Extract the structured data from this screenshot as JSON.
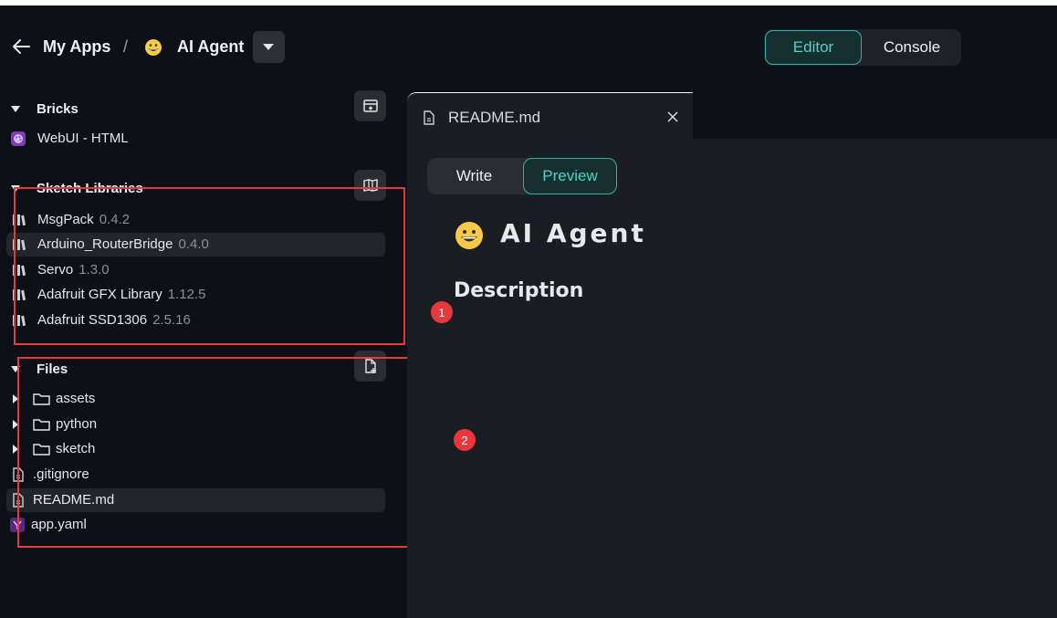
{
  "header": {
    "back_icon": "arrow-left-icon",
    "breadcrumb_root": "My Apps",
    "separator": "/",
    "app_emoji_icon": "grinning-face-icon",
    "app_name": "AI Agent",
    "dropdown_icon": "caret-down-icon"
  },
  "mode_toggle": {
    "editor": "Editor",
    "console": "Console",
    "active": "Editor"
  },
  "sidebar": {
    "bricks": {
      "title": "Bricks",
      "action_icon": "add-brick-icon",
      "items": [
        {
          "label": "WebUI - HTML",
          "icon": "palette-icon"
        }
      ]
    },
    "sketch_libraries": {
      "title": "Sketch Libraries",
      "action_icon": "add-library-icon",
      "items": [
        {
          "label": "MsgPack",
          "version": "0.4.2",
          "icon": "library-icon"
        },
        {
          "label": "Arduino_RouterBridge",
          "version": "0.4.0",
          "icon": "library-icon"
        },
        {
          "label": "Servo",
          "version": "1.3.0",
          "icon": "library-icon"
        },
        {
          "label": "Adafruit GFX Library",
          "version": "1.12.5",
          "icon": "library-icon"
        },
        {
          "label": "Adafruit SSD1306",
          "version": "2.5.16",
          "icon": "library-icon"
        }
      ]
    },
    "files": {
      "title": "Files",
      "action_icon": "add-file-icon",
      "items": [
        {
          "label": "assets",
          "type": "folder",
          "icon": "folder-icon"
        },
        {
          "label": "python",
          "type": "folder",
          "icon": "folder-icon"
        },
        {
          "label": "sketch",
          "type": "folder",
          "icon": "folder-icon"
        },
        {
          "label": ".gitignore",
          "type": "file",
          "icon": "file-icon"
        },
        {
          "label": "README.md",
          "type": "file",
          "icon": "file-icon",
          "selected": true
        },
        {
          "label": "app.yaml",
          "type": "file",
          "icon": "yaml-icon"
        }
      ]
    }
  },
  "editor": {
    "tab": {
      "label": "README.md",
      "icon": "file-icon",
      "close_icon": "close-icon"
    },
    "view_toggle": {
      "write": "Write",
      "preview": "Preview",
      "active": "Preview"
    },
    "preview": {
      "h1_emoji_icon": "grinning-face-icon",
      "h1": "AI Agent",
      "h2": "Description"
    }
  },
  "annotations": [
    {
      "label": "1"
    },
    {
      "label": "2"
    }
  ],
  "colors": {
    "background": "#0d1117",
    "panel": "#1a1e22",
    "accent": "#2bb3b3",
    "annotation": "#e8383d"
  }
}
